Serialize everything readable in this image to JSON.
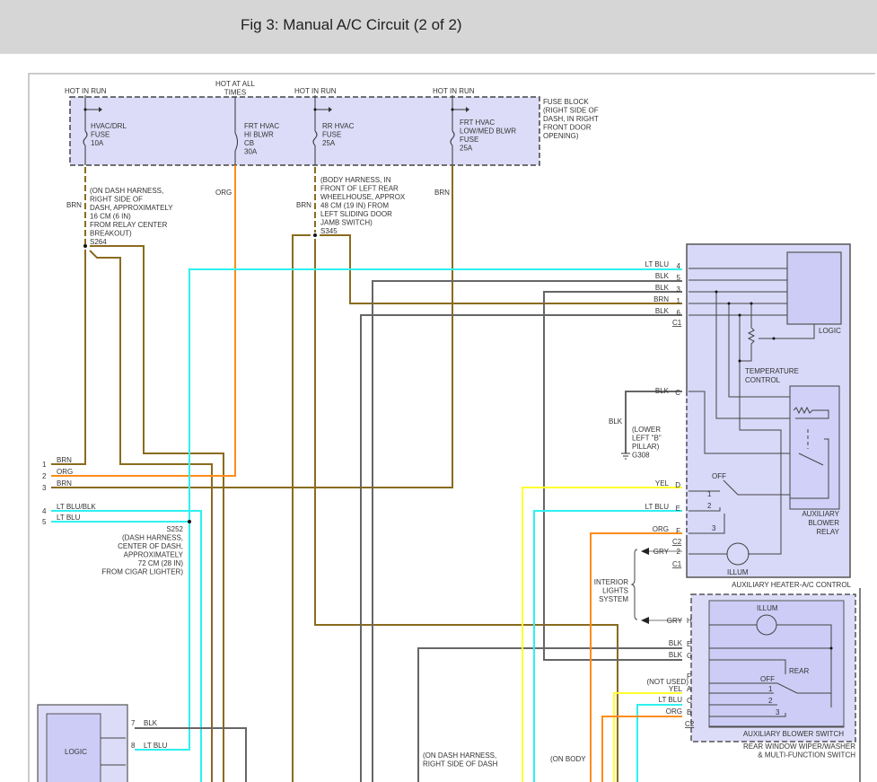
{
  "title": "Fig 3: Manual A/C Circuit (2 of 2)",
  "colors": {
    "brn": "#8a6b1e",
    "org": "#ff8c1a",
    "lt_blu": "#2ff0f0",
    "yel": "#ffff2e",
    "blk": "#666666",
    "gry": "#bbbbbb",
    "component_fill": "#d8d8f8"
  },
  "fuse_block": {
    "label": [
      "FUSE BLOCK",
      "(RIGHT SIDE OF",
      "DASH, IN RIGHT",
      "FRONT DOOR",
      "OPENING)"
    ],
    "fuses": [
      {
        "supply": [
          "HOT IN RUN"
        ],
        "name": [
          "HVAC/DRL",
          "FUSE",
          "10A"
        ],
        "wire": "BRN"
      },
      {
        "supply": [
          "HOT AT ALL",
          "TIMES"
        ],
        "name": [
          "FRT HVAC",
          "HI BLWR",
          "CB",
          "30A"
        ],
        "wire": "ORG"
      },
      {
        "supply": [
          "HOT IN RUN"
        ],
        "name": [
          "RR HVAC",
          "FUSE",
          "25A"
        ],
        "wire": "BRN"
      },
      {
        "supply": [
          "HOT IN RUN"
        ],
        "name": [
          "FRT HVAC",
          "LOW/MED BLWR",
          "FUSE",
          "25A"
        ],
        "wire": "BRN"
      }
    ]
  },
  "splices": {
    "s264": [
      "(ON DASH HARNESS,",
      "RIGHT SIDE OF",
      "DASH, APPROXIMATELY",
      "16 CM (6 IN)",
      "FROM RELAY CENTER",
      "BREAKOUT)",
      "S264"
    ],
    "s345": [
      "(BODY HARNESS, IN",
      "FRONT OF LEFT REAR",
      "WHEELHOUSE, APPROX",
      "48 CM (19 IN) FROM",
      "LEFT SLIDING DOOR",
      "JAMB SWITCH)",
      "S345"
    ],
    "s252": [
      "S252",
      "(DASH HARNESS,",
      "CENTER OF DASH,",
      "APPROXIMATELY",
      "72 CM (28 IN)",
      "FROM CIGAR LIGHTER)"
    ]
  },
  "left_connector": [
    {
      "pin": "1",
      "wire": "BRN"
    },
    {
      "pin": "2",
      "wire": "ORG"
    },
    {
      "pin": "3",
      "wire": "BRN"
    },
    {
      "pin": "4",
      "wire": "LT BLU/BLK"
    },
    {
      "pin": "5",
      "wire": "LT BLU"
    }
  ],
  "aux_control": {
    "name": "AUXILIARY HEATER-A/C CONTROL",
    "c1_pins": [
      {
        "pin": "4",
        "wire": "LT BLU"
      },
      {
        "pin": "5",
        "wire": "BLK"
      },
      {
        "pin": "3",
        "wire": "BLK"
      },
      {
        "pin": "1",
        "wire": "BRN"
      },
      {
        "pin": "6",
        "wire": "BLK"
      }
    ],
    "c1": "C1",
    "logic": "LOGIC",
    "temp_control": [
      "TEMPERATURE",
      "CONTROL"
    ],
    "pin_c": {
      "pin": "C",
      "wire": "BLK"
    },
    "ground": {
      "wire": "BLK",
      "note": [
        "(LOWER",
        "LEFT \"B\"",
        "PILLAR)",
        "G308"
      ]
    },
    "c2_pins": [
      {
        "pin": "D",
        "wire": "YEL"
      },
      {
        "pin": "E",
        "wire": "LT BLU"
      },
      {
        "pin": "F",
        "wire": "ORG"
      }
    ],
    "c2": "C2",
    "gry_pin": {
      "pin": "2",
      "wire": "GRY",
      "connector": "C1"
    },
    "switch": {
      "off": "OFF",
      "positions": [
        "1",
        "2",
        "3"
      ]
    },
    "relay": [
      "AUXILIARY",
      "BLOWER",
      "RELAY"
    ],
    "illum": "ILLUM"
  },
  "interior_lights": [
    "INTERIOR",
    "LIGHTS",
    "SYSTEM"
  ],
  "rear_switch": {
    "name": [
      "REAR WINDOW WIPER/WASHER",
      "& MULTI-FUNCTION SWITCH"
    ],
    "inner": "AUXILIARY BLOWER SWITCH",
    "illum": "ILLUM",
    "rear": "REAR",
    "off": "OFF",
    "positions": [
      "1",
      "2",
      "3"
    ],
    "pins": [
      {
        "pin": "H",
        "wire": "GRY"
      },
      {
        "pin": "E",
        "wire": "BLK"
      },
      {
        "pin": "G",
        "wire": "BLK"
      },
      {
        "pin": "F",
        "wire": "(NOT USED)"
      },
      {
        "pin": "A",
        "wire": "YEL"
      },
      {
        "pin": "C",
        "wire": "LT BLU"
      },
      {
        "pin": "B",
        "wire": "ORG"
      }
    ],
    "c2": "C2"
  },
  "bottom_logic": {
    "label": "LOGIC",
    "pins": [
      {
        "pin": "7",
        "wire": "BLK"
      },
      {
        "pin": "8",
        "wire": "LT BLU"
      }
    ]
  },
  "bottom_notes": {
    "dash": [
      "(ON DASH HARNESS,",
      "RIGHT SIDE OF DASH"
    ],
    "body": [
      "(ON BODY"
    ]
  }
}
